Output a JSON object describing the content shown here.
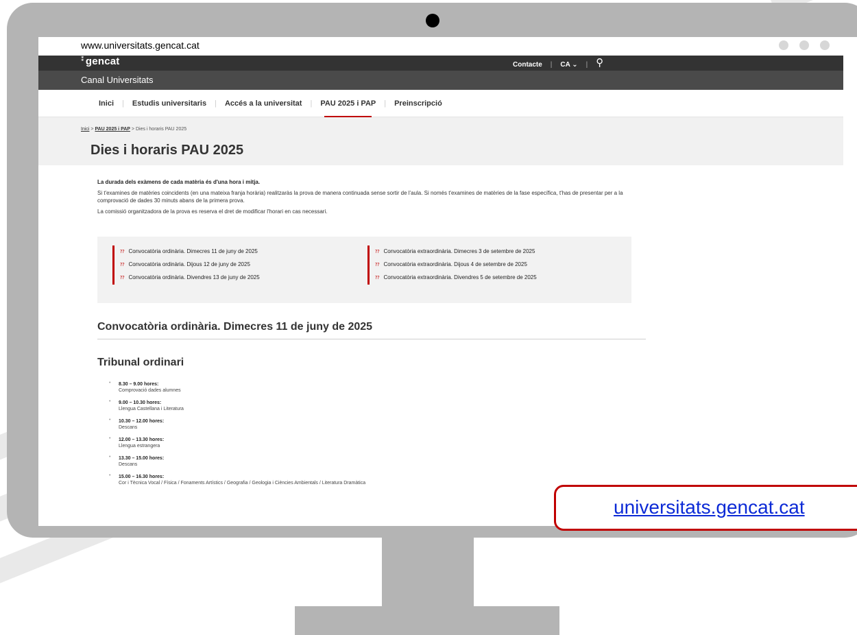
{
  "browser": {
    "url": "www.universitats.gencat.cat"
  },
  "header": {
    "logo": "gencat",
    "contact": "Contacte",
    "language": "CA",
    "channel_title": "Canal Universitats"
  },
  "nav": {
    "items": [
      {
        "label": "Inici"
      },
      {
        "label": "Estudis universitaris"
      },
      {
        "label": "Accés a la universitat"
      },
      {
        "label": "PAU 2025 i PAP",
        "active": true
      },
      {
        "label": "Preinscripció"
      }
    ]
  },
  "breadcrumb": {
    "home": "Inici",
    "section": "PAU 2025 i PAP",
    "current": "Dies i horaris PAU 2025"
  },
  "page": {
    "title": "Dies i horaris PAU 2025",
    "intro_bold": "La durada dels exàmens de cada matèria és d'una hora i mitja.",
    "intro_p1": "Si t'examines de matèries coincidents (en una mateixa franja horària) realitzaràs la prova de manera continuada sense sortir de l'aula. Si només t'examines de matèries de la fase específica, t'has de presentar per a la comprovació de dades 30 minuts abans de la primera prova.",
    "intro_p2": "La comissió organitzadora de la prova es reserva el dret de modificar l'horari en cas necessari."
  },
  "dates": {
    "ordinary": [
      "Convocatòria ordinària. Dimecres 11 de juny de 2025",
      "Convocatòria ordinària. Dijous 12 de juny de 2025",
      "Convocatòria ordinària. Divendres 13 de juny de 2025"
    ],
    "extraordinary": [
      "Convocatòria extraordinària. Dimecres 3 de setembre de 2025",
      "Convocatòria extraordinària. Dijous 4 de setembre de 2025",
      "Convocatòria extraordinària. Divendres 5 de setembre de 2025"
    ]
  },
  "section": {
    "heading": "Convocatòria ordinària. Dimecres 11 de juny de 2025",
    "subheading": "Tribunal ordinari"
  },
  "schedule": [
    {
      "time": "8.30 – 9.00 hores:",
      "subject": "Comprovació dades alumnes"
    },
    {
      "time": "9.00 – 10.30 hores:",
      "subject": "Llengua Castellana i Literatura"
    },
    {
      "time": "10.30 – 12.00 hores:",
      "subject": "Descans"
    },
    {
      "time": "12.00 – 13.30 hores:",
      "subject": "Llengua estrangera"
    },
    {
      "time": "13.30 – 15.00 hores:",
      "subject": "Descans"
    },
    {
      "time": "15.00 – 16.30 hores:",
      "subject": "Cor i Tècnica Vocal / Física / Fonaments Artístics / Geografia / Geologia i Ciències Ambientals / Literatura Dramàtica"
    }
  ],
  "overlay": {
    "link_text": "universitats.gencat.cat"
  },
  "colors": {
    "accent": "#c00000",
    "header_dark": "#333333",
    "monitor": "#b4b4b4",
    "link": "#0b29d6"
  }
}
